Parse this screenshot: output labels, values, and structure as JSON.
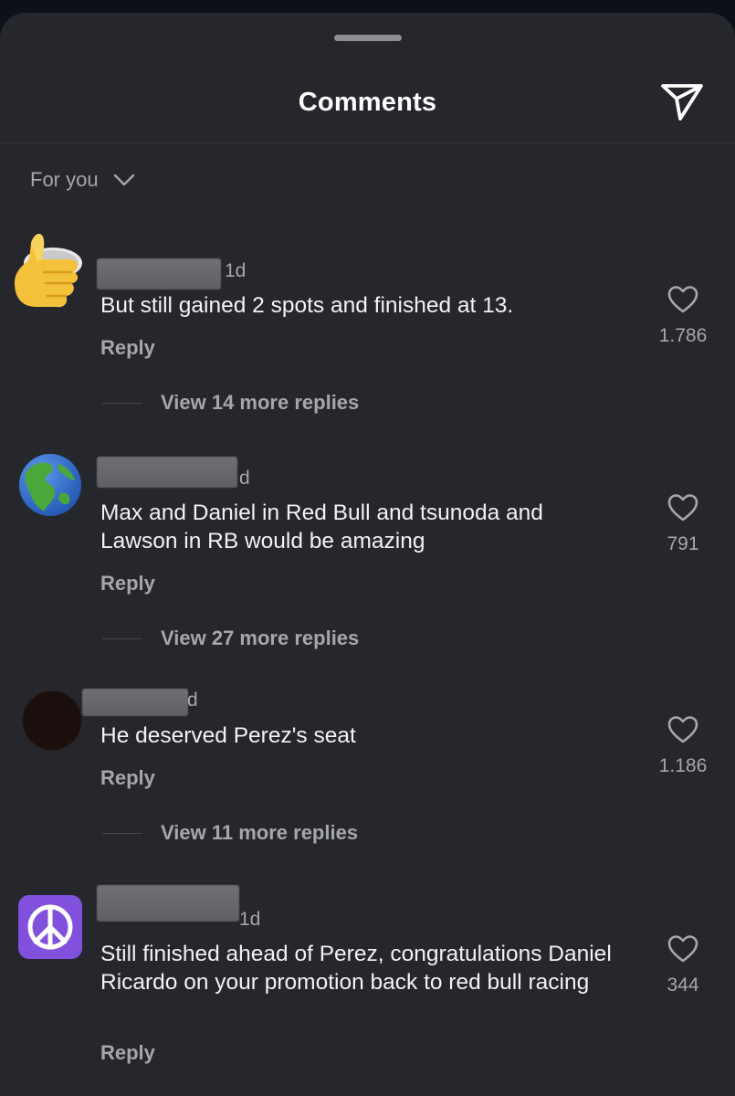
{
  "header": {
    "title": "Comments"
  },
  "filter": {
    "label": "For you"
  },
  "comments": [
    {
      "time": "1d",
      "text": "But still gained 2 spots and finished at 13.",
      "reply_label": "Reply",
      "likes": "1.786",
      "replies_label": "View 14 more replies",
      "avatar": "thumbs-up-emoji"
    },
    {
      "time": "d",
      "text": "Max and Daniel in Red Bull and tsunoda and Lawson in RB would be amazing",
      "reply_label": "Reply",
      "likes": "791",
      "replies_label": "View 27 more replies",
      "avatar": "globe-americas-emoji"
    },
    {
      "time": "d",
      "text": "He deserved Perez's seat",
      "reply_label": "Reply",
      "likes": "1.186",
      "replies_label": "View 11 more replies",
      "avatar": "dark-avatar"
    },
    {
      "time": "1d",
      "text": "Still finished ahead of Perez, congratulations Daniel Ricardo on your promotion back to red bull racing",
      "reply_label": "Reply",
      "likes": "344",
      "avatar": "peace-symbol-emoji"
    }
  ],
  "colors": {
    "sheet_bg": "#25272c",
    "text_primary": "#f2f2f4",
    "text_secondary": "#a5a7ab"
  }
}
